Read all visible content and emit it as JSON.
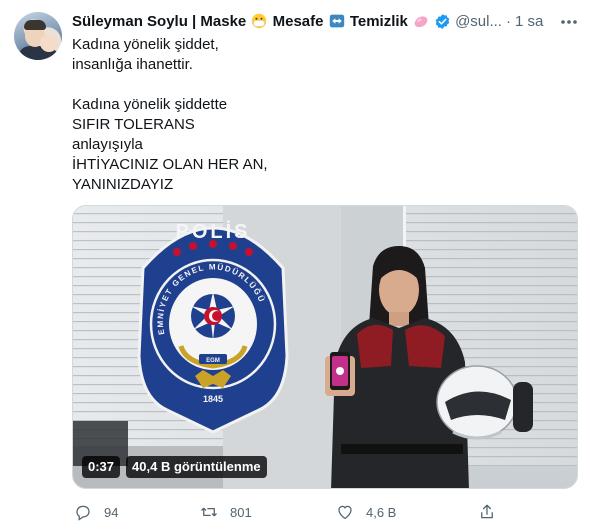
{
  "tweet": {
    "author": {
      "name_part1": "Süleyman Soylu | Maske",
      "name_part2": "Mesafe",
      "name_part3": "Temizlik",
      "handle": "@sul...",
      "time": "1 sa"
    },
    "text_lines": [
      "Kadına yönelik şiddet,",
      "insanlığa ihanettir.",
      "",
      "Kadına yönelik şiddette",
      "SIFIR TOLERANS",
      "anlayışıyla",
      "İHTİYACINIZ OLAN HER AN,",
      "YANINIZDAYIZ"
    ],
    "video": {
      "duration": "0:37",
      "views": "40,4 B görüntülenme",
      "badge_text_top": "POLİS",
      "badge_text_ring": "EMNİYET GENEL MÜDÜRLÜĞÜ",
      "badge_egm": "EGM",
      "badge_year": "1845"
    },
    "actions": {
      "replies": "94",
      "retweets": "801",
      "likes": "4,6 B"
    }
  },
  "icons": [
    "mask-emoji-icon",
    "arrows-emoji-icon",
    "soap-emoji-icon",
    "verified-badge-icon",
    "more-icon",
    "reply-icon",
    "retweet-icon",
    "like-icon",
    "share-icon"
  ],
  "colors": {
    "verified": "#1d9bf0",
    "secondary_text": "#536471",
    "badge_blue": "#1f3f8f",
    "jacket_red": "#8e1c22"
  }
}
